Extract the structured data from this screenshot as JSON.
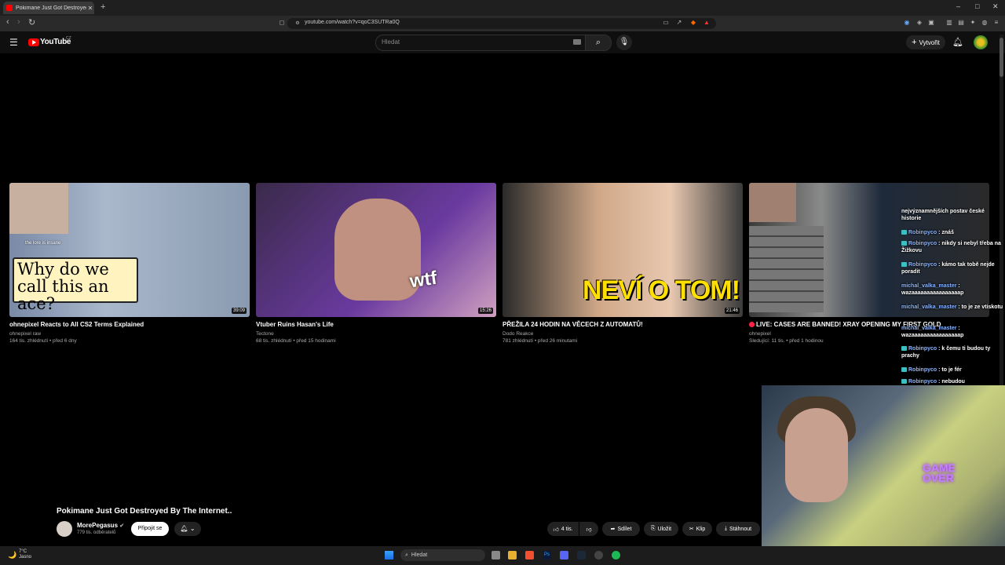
{
  "browser": {
    "tab_title": "Pokimane Just Got Destroyed B...",
    "url": "youtube.com/watch?v=qoC3SUTRa0Q"
  },
  "youtube": {
    "logo_text": "YouTube",
    "region": "CZ",
    "search_placeholder": "Hledat",
    "create_label": "Vytvořit"
  },
  "videos": [
    {
      "title": "ohnepixel Reacts to All CS2 Terms Explained",
      "channel": "ohnepixel raw",
      "meta": "164 tis. zhlédnutí • před 6 dny",
      "duration": "39:09",
      "thumb_text": "Why do we call this an ace?",
      "thumb_caption": "the lore is insane"
    },
    {
      "title": "Vtuber Ruins Hasan's Life",
      "channel": "Tectone",
      "meta": "68 tis. zhlédnutí • před 15 hodinami",
      "duration": "15:26",
      "thumb_text": "wtf"
    },
    {
      "title": "PŘEŽILA 24 HODIN NA VĚCECH Z AUTOMATŮ!",
      "channel": "Dodo Reakce",
      "meta": "781 zhlédnutí • před 26 minutami",
      "duration": "21:46",
      "thumb_text": "NEVÍ O TOM!"
    },
    {
      "title": "LIVE: CASES ARE BANNED! XRAY OPENING MY FIRST GOLD",
      "channel": "ohnepixel",
      "meta": "Sledující: 11 tis. • před 1 hodinou"
    }
  ],
  "chat": [
    {
      "user": "",
      "text": "nejvýznamnějších postav české historie"
    },
    {
      "user": "Robinpyco",
      "text": ": znáš"
    },
    {
      "user": "Robinpyco",
      "text": ": nikdy si nebyl třeba na Žižkovu"
    },
    {
      "user": "Robinpyco",
      "text": ": kámo tak tobě nejde poradit"
    },
    {
      "user": "michal_valka_master",
      "text": ": wazaaaaaaaaaaaaaaaap"
    },
    {
      "user": "michal_valka_master",
      "text": ": to je ze vtiskotu"
    },
    {
      "user": "michal_valka_master",
      "text": ": wazaaaaaaaaaaaaaaaap"
    },
    {
      "user": "Robinpyco",
      "text": ": k čemu ti budou ty prachy"
    },
    {
      "user": "Robinpyco",
      "text": ": to je fér"
    },
    {
      "user": "Robinpyco",
      "text": ": nebudou"
    }
  ],
  "webcam": {
    "sign_text": "GAME OVER"
  },
  "current_video": {
    "title": "Pokimane Just Got Destroyed By The Internet..",
    "channel": "MorePegasus",
    "subscribers": "779 tis. odběratelů",
    "join_label": "Připojit se",
    "likes": "4 tis.",
    "share_label": "Sdílet",
    "save_label": "Uložit",
    "clip_label": "Klip",
    "download_label": "Stáhnout"
  },
  "taskbar": {
    "temperature": "7°C",
    "weather": "Jasno",
    "search_label": "Hledat"
  }
}
